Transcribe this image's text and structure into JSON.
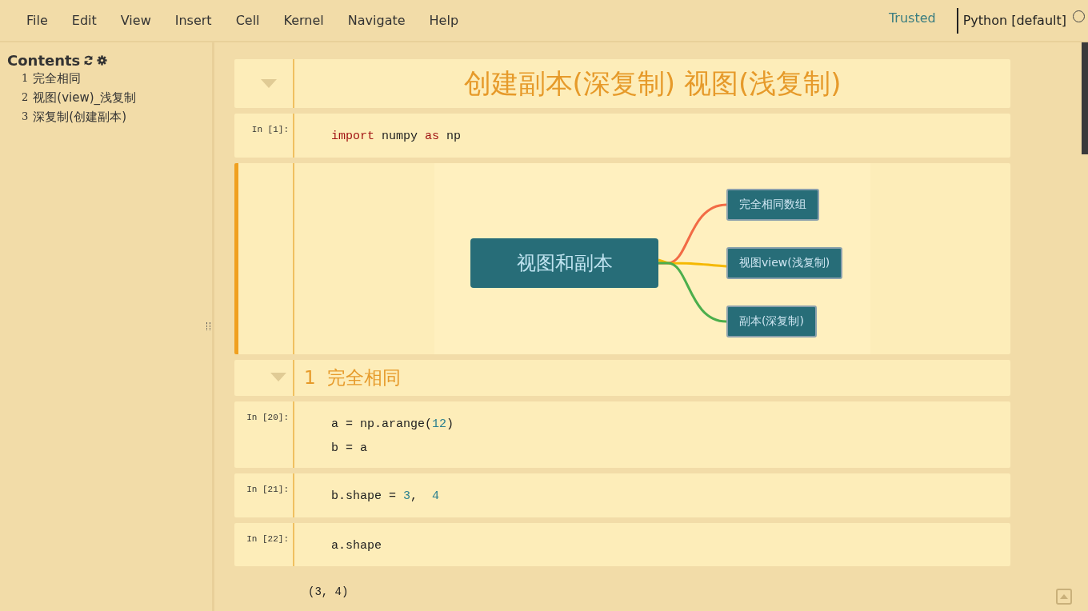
{
  "menubar": {
    "items": [
      "File",
      "Edit",
      "View",
      "Insert",
      "Cell",
      "Kernel",
      "Navigate",
      "Help"
    ],
    "trusted": "Trusted",
    "kernel": "Python [default]",
    "kernel_busy": false
  },
  "toc": {
    "title": "Contents",
    "items": [
      {
        "number": "1",
        "label": "完全相同"
      },
      {
        "number": "2",
        "label": "视图(view)_浅复制"
      },
      {
        "number": "3",
        "label": "深复制(创建副本)"
      }
    ]
  },
  "cells": [
    {
      "kind": "title",
      "text": "创建副本(深复制) 视图(浅复制)",
      "expanded": true,
      "selected": false
    },
    {
      "kind": "code",
      "prompt": "In [1]:",
      "selected": false,
      "lines": [
        [
          {
            "t": "import",
            "kind": "keyword"
          },
          {
            "t": " numpy ",
            "kind": "plain"
          },
          {
            "t": "as",
            "kind": "keyword"
          },
          {
            "t": " np",
            "kind": "plain"
          }
        ]
      ]
    },
    {
      "kind": "mindmap",
      "selected": true,
      "root": "视图和副本",
      "branches": [
        {
          "label": "完全相同数组",
          "color": "#f26b45"
        },
        {
          "label": "视图view(浅复制)",
          "color": "#f5b800"
        },
        {
          "label": "副本(深复制)",
          "color": "#4cae4c"
        }
      ]
    },
    {
      "kind": "heading",
      "number": "1",
      "text": "完全相同",
      "expanded": true,
      "selected": false
    },
    {
      "kind": "code",
      "prompt": "In [20]:",
      "selected": false,
      "lines": [
        [
          {
            "t": "a = np.arange(",
            "kind": "plain"
          },
          {
            "t": "12",
            "kind": "number"
          },
          {
            "t": ")",
            "kind": "plain"
          }
        ],
        [
          {
            "t": "b = a",
            "kind": "plain"
          }
        ]
      ]
    },
    {
      "kind": "code",
      "prompt": "In [21]:",
      "selected": false,
      "lines": [
        [
          {
            "t": "b.shape = ",
            "kind": "plain"
          },
          {
            "t": "3",
            "kind": "number"
          },
          {
            "t": ",  ",
            "kind": "plain"
          },
          {
            "t": "4",
            "kind": "number"
          }
        ]
      ]
    },
    {
      "kind": "code",
      "prompt": "In [22]:",
      "selected": false,
      "lines": [
        [
          {
            "t": "a.shape",
            "kind": "plain"
          }
        ]
      ]
    },
    {
      "kind": "output",
      "text": "(3,  4)"
    }
  ]
}
